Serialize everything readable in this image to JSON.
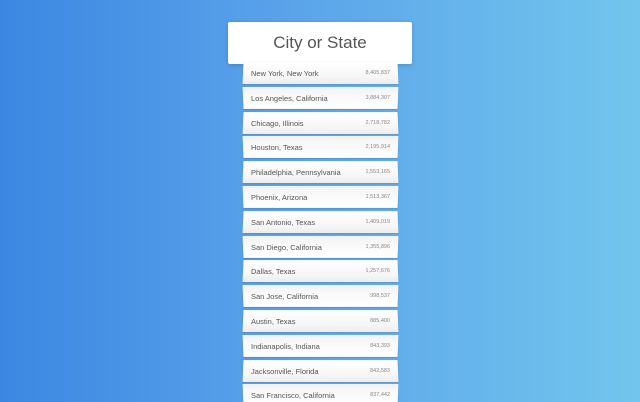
{
  "search": {
    "placeholder": "City or State"
  },
  "suggestions": [
    {
      "name": "New York, New York",
      "population": "8,405,837"
    },
    {
      "name": "Los Angeles, California",
      "population": "3,884,307"
    },
    {
      "name": "Chicago, Illinois",
      "population": "2,718,782"
    },
    {
      "name": "Houston, Texas",
      "population": "2,195,914"
    },
    {
      "name": "Philadelphia, Pennsylvania",
      "population": "1,553,165"
    },
    {
      "name": "Phoenix, Arizona",
      "population": "1,513,367"
    },
    {
      "name": "San Antonio, Texas",
      "population": "1,409,019"
    },
    {
      "name": "San Diego, California",
      "population": "1,355,896"
    },
    {
      "name": "Dallas, Texas",
      "population": "1,257,676"
    },
    {
      "name": "San Jose, California",
      "population": "998,537"
    },
    {
      "name": "Austin, Texas",
      "population": "885,400"
    },
    {
      "name": "Indianapolis, Indiana",
      "population": "843,393"
    },
    {
      "name": "Jacksonville, Florida",
      "population": "842,583"
    },
    {
      "name": "San Francisco, California",
      "population": "837,442"
    }
  ]
}
